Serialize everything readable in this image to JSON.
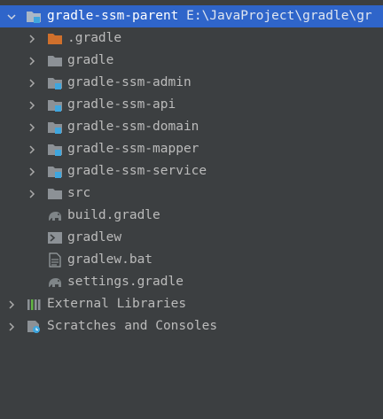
{
  "project": {
    "root_label": "gradle-ssm-parent",
    "root_path": "E:\\JavaProject\\gradle\\gr"
  },
  "tree": {
    "items": [
      {
        "label": ".gradle",
        "icon": "folder-orange-icon"
      },
      {
        "label": "gradle",
        "icon": "folder-icon"
      },
      {
        "label": "gradle-ssm-admin",
        "icon": "module-folder-icon"
      },
      {
        "label": "gradle-ssm-api",
        "icon": "module-folder-icon"
      },
      {
        "label": "gradle-ssm-domain",
        "icon": "module-folder-icon"
      },
      {
        "label": "gradle-ssm-mapper",
        "icon": "module-folder-icon"
      },
      {
        "label": "gradle-ssm-service",
        "icon": "module-folder-icon"
      },
      {
        "label": "src",
        "icon": "folder-icon"
      },
      {
        "label": "build.gradle",
        "icon": "gradle-elephant-icon"
      },
      {
        "label": "gradlew",
        "icon": "terminal-file-icon"
      },
      {
        "label": "gradlew.bat",
        "icon": "text-file-icon"
      },
      {
        "label": "settings.gradle",
        "icon": "gradle-elephant-icon"
      }
    ],
    "external_libraries": "External Libraries",
    "scratches": "Scratches and Consoles"
  },
  "colors": {
    "background": "#3c3f41",
    "selection": "#2f65ca",
    "folder": "#8c9196",
    "folder_orange": "#d0702c",
    "module_badge": "#3fa6de",
    "text": "#bbbbbb"
  }
}
